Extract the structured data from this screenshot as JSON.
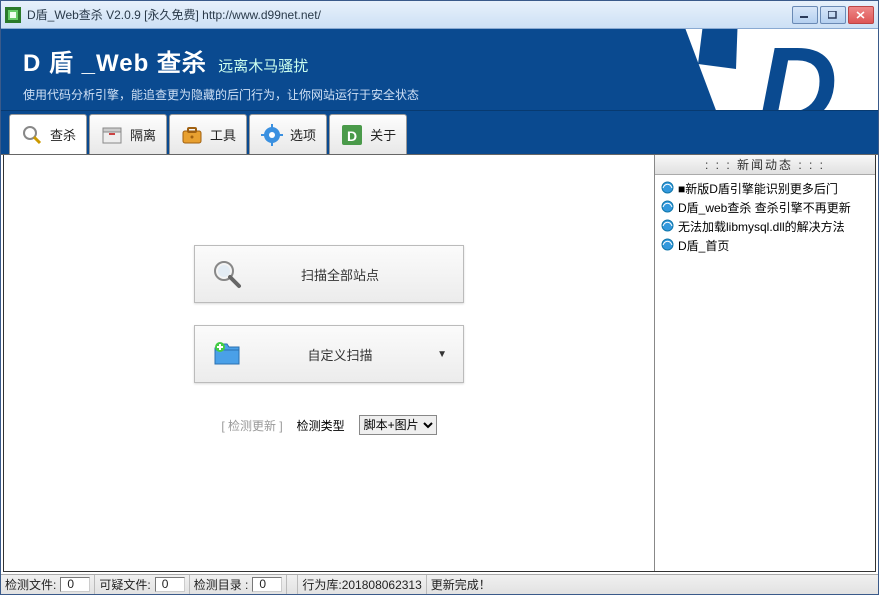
{
  "titlebar": {
    "text": "D盾_Web查杀 V2.0.9 [永久免费] http://www.d99net.net/"
  },
  "banner": {
    "title_bold": "D 盾 _Web 查杀",
    "title_sub": "远离木马骚扰",
    "desc": "使用代码分析引擎，能追查更为隐藏的后门行为，让你网站运行于安全状态"
  },
  "tabs": {
    "scan": "查杀",
    "quarantine": "隔离",
    "tools": "工具",
    "options": "选项",
    "about": "关于"
  },
  "main": {
    "scan_all": "扫描全部站点",
    "custom_scan": "自定义扫描",
    "check_update": "[ 检测更新 ]",
    "detect_type_label": "检测类型",
    "detect_type_value": "脚本+图片"
  },
  "news": {
    "heading": ": : :  新闻动态  : : :",
    "items": [
      "■新版D盾引擎能识别更多后门",
      "D盾_web查杀 查杀引擎不再更新",
      "无法加载libmysql.dll的解决方法",
      "D盾_首页"
    ]
  },
  "status": {
    "files_label": "检测文件:",
    "files_val": "0",
    "sus_label": "可疑文件:",
    "sus_val": "0",
    "dirs_label": "检测目录 :",
    "dirs_val": "0",
    "db_label": "行为库:201808062313",
    "done": "更新完成！"
  }
}
